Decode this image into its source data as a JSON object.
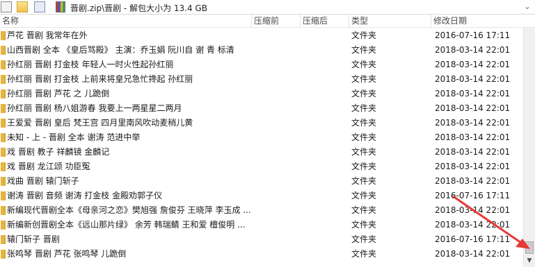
{
  "address": {
    "path": "晋剧.zip\\晋剧 - 解包大小为 13.4 GB",
    "dropdown_glyph": "⌄"
  },
  "columns": {
    "name": "名称",
    "packed": "压缩前",
    "unpacked": "压缩后",
    "type": "类型",
    "modified": "修改日期"
  },
  "rows": [
    {
      "name": "芦花 晋剧 我常年在外",
      "type": "文件夹",
      "date": "2016-07-16 17:11"
    },
    {
      "name": "山西晋剧 全本 《皇后骂殿》 主演：乔玉娟 阮川自 谢 青 标清",
      "type": "文件夹",
      "date": "2018-03-14 22:01"
    },
    {
      "name": "孙红丽 晋剧 打金枝 年轻人一时火性起孙红丽",
      "type": "文件夹",
      "date": "2018-03-14 22:01"
    },
    {
      "name": "孙红丽 晋剧 打金枝 上前来将皇兄急忙搀起 孙红丽",
      "type": "文件夹",
      "date": "2018-03-14 22:01"
    },
    {
      "name": "孙红丽 晋剧 芦花 之 儿跪倒",
      "type": "文件夹",
      "date": "2018-03-14 22:01"
    },
    {
      "name": "孙红丽 晋剧 杨八姐游春 我要上一两星星二两月",
      "type": "文件夹",
      "date": "2018-03-14 22:01"
    },
    {
      "name": "王爱爱 晋剧 皇后 梵王宫 四月里南风吹动麦稍儿黄",
      "type": "文件夹",
      "date": "2018-03-14 22:01"
    },
    {
      "name": "未知 - 上 - 晋剧 全本 谢涛 范进中举",
      "type": "文件夹",
      "date": "2018-03-14 22:01"
    },
    {
      "name": "戏 晋剧 教子 祥麟镜 金麟记",
      "type": "文件夹",
      "date": "2018-03-14 22:01"
    },
    {
      "name": "戏 晋剧 龙江颂 功臣冤",
      "type": "文件夹",
      "date": "2018-03-14 22:01"
    },
    {
      "name": "戏曲 晋剧 辕门斩子",
      "type": "文件夹",
      "date": "2018-03-14 22:01"
    },
    {
      "name": "谢涛 晋剧 音频 谢涛 打金枝 金殿劝郭子仪",
      "type": "文件夹",
      "date": "2016-07-16 17:11"
    },
    {
      "name": "新编现代晋剧全本《母亲河之恋》樊旭强 詹俊芬 王晓萍 李玉成 ...",
      "type": "文件夹",
      "date": "2018-03-14 22:01"
    },
    {
      "name": "新编新创晋剧全本《远山那片绿》 余芳 韩瑞鲭 王和爱 檀俊明 ...",
      "type": "文件夹",
      "date": "2018-03-14 22:01"
    },
    {
      "name": "辕门斩子 晋剧",
      "type": "文件夹",
      "date": "2016-07-16 17:11"
    },
    {
      "name": "张鸣琴 晋剧 芦花 张鸣琴 儿跪倒",
      "type": "文件夹",
      "date": "2018-03-14 22:01"
    }
  ],
  "colors": {
    "folder": "#e7b53e",
    "annotation_arrow": "#e53935",
    "header_text": "#4a4a4a"
  }
}
